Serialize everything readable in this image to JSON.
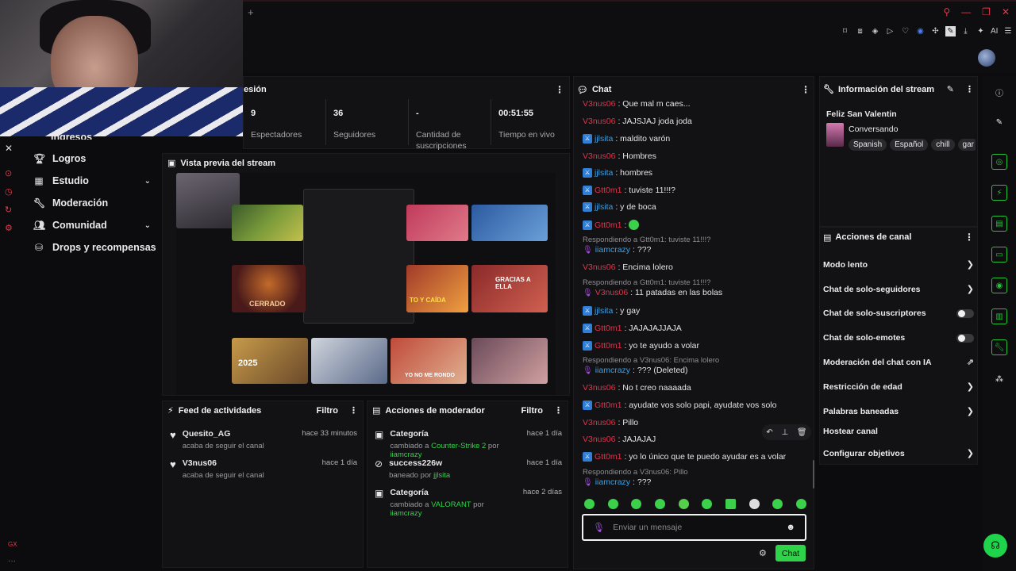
{
  "browser": {
    "new_tab": "+",
    "window_controls": [
      "⚲",
      "—",
      "❐",
      "✕"
    ],
    "ai_label": "AI"
  },
  "sidebar": {
    "partial_item": "Ingresos",
    "items": [
      {
        "label": "Logros",
        "icon": "trophy-icon"
      },
      {
        "label": "Estudio",
        "icon": "table-icon",
        "expandable": true
      },
      {
        "label": "Moderación",
        "icon": "wrench-icon"
      },
      {
        "label": "Comunidad",
        "icon": "people-icon",
        "expandable": true
      },
      {
        "label": "Drops y recompensas",
        "icon": "gift-icon"
      }
    ]
  },
  "session": {
    "title_partial": "esión",
    "stats": [
      {
        "value": "9",
        "label": "Espectadores"
      },
      {
        "value": "36",
        "label": "Seguidores"
      },
      {
        "value": "-",
        "label": "Cantidad de suscripciones"
      },
      {
        "value": "00:51:55",
        "label": "Tiempo en vivo"
      }
    ]
  },
  "preview": {
    "title": "Vista previa del stream",
    "thumb_texts": [
      "CERRADO",
      "2025",
      "GRACIAS A ELLA",
      "YO NO ME RONDO",
      "TO Y CAÍDA"
    ]
  },
  "feed": {
    "title": "Feed de actividades",
    "filter": "Filtro",
    "items": [
      {
        "user": "Quesito_AG",
        "action": "acaba de seguir el canal",
        "time": "hace 33 minutos"
      },
      {
        "user": "V3nus06",
        "action": "acaba de seguir el canal",
        "time": "hace 1 día"
      }
    ]
  },
  "mod_actions": {
    "title": "Acciones de moderador",
    "filter": "Filtro",
    "items": [
      {
        "title": "Categoría",
        "prefix": "cambiado a ",
        "target": "Counter-Strike 2",
        "by": " por ",
        "mod": "iiamcrazy",
        "time": "hace 1 día"
      },
      {
        "title": "success226w",
        "prefix": "baneado por ",
        "target": "",
        "by": "",
        "mod": "jjlsita",
        "time": "hace 1 día"
      },
      {
        "title": "Categoría",
        "prefix": "cambiado a ",
        "target": "VALORANT",
        "by": " por ",
        "mod": "iiamcrazy",
        "time": "hace 2 días"
      }
    ]
  },
  "chat": {
    "title": "Chat",
    "messages": [
      {
        "nick": "V3nus06",
        "color": "red",
        "text": ": Que mal m caes..."
      },
      {
        "nick": "V3nus06",
        "color": "red",
        "text": ": JAJSJAJ joda joda"
      },
      {
        "nick": "jjlsita",
        "color": "blue",
        "badge": true,
        "text": ": maldito varón"
      },
      {
        "nick": "V3nus06",
        "color": "red",
        "text": ": Hombres"
      },
      {
        "nick": "jjlsita",
        "color": "blue",
        "badge": true,
        "text": ": hombres"
      },
      {
        "nick": "Gtt0m1",
        "color": "red",
        "badge": true,
        "text": ": tuviste 11!!!?"
      },
      {
        "nick": "jjlsita",
        "color": "blue",
        "badge": true,
        "text": ": y de boca"
      },
      {
        "nick": "Gtt0m1",
        "color": "red",
        "badge": true,
        "text": ":",
        "emote": true
      },
      {
        "reply": "Respondiendo a Gtt0m1: tuviste 11!!!?",
        "nick": "iiamcrazy",
        "color": "blue",
        "text": ": ???"
      },
      {
        "nick": "V3nus06",
        "color": "red",
        "text": ": Encima lolero"
      },
      {
        "reply": "Respondiendo a Gtt0m1: tuviste 11!!!?",
        "nick": "V3nus06",
        "color": "red",
        "text": ": 11 patadas en las bolas"
      },
      {
        "nick": "jjlsita",
        "color": "blue",
        "badge": true,
        "text": ": y gay"
      },
      {
        "nick": "Gtt0m1",
        "color": "red",
        "badge": true,
        "text": ": JAJAJAJJAJA"
      },
      {
        "nick": "Gtt0m1",
        "color": "red",
        "badge": true,
        "text": ": yo te ayudo a volar"
      },
      {
        "reply": "Respondiendo a V3nus06: Encima lolero",
        "nick": "iiamcrazy",
        "color": "blue",
        "text": ": ??? (Deleted)"
      },
      {
        "nick": "V3nus06",
        "color": "red",
        "text": ": No t creo naaaada"
      },
      {
        "nick": "Gtt0m1",
        "color": "red",
        "badge": true,
        "text": ": ayudate vos solo papi, ayudate vos solo"
      },
      {
        "nick": "V3nus06",
        "color": "red",
        "text": ": Pillo"
      },
      {
        "nick": "V3nus06",
        "color": "red",
        "text": ": JAJAJAJ"
      },
      {
        "nick": "Gtt0m1",
        "color": "red",
        "badge": true,
        "text": ": yo lo único que te puedo ayudar es a volar"
      },
      {
        "reply": "Respondiendo a V3nus06: Pillo",
        "nick": "iiamcrazy",
        "color": "blue",
        "text": ": ???"
      }
    ],
    "input_placeholder": "Enviar un mensaje",
    "send_label": "Chat"
  },
  "stream_info": {
    "title": "Información del stream",
    "stream_title": "Feliz San Valentin",
    "category": "Conversando",
    "tags": [
      "Spanish",
      "Español",
      "chill",
      "gar"
    ]
  },
  "channel_actions": {
    "title": "Acciones de canal",
    "items": [
      {
        "label": "Modo lento",
        "control": "chevron"
      },
      {
        "label": "Chat de solo-seguidores",
        "control": "chevron"
      },
      {
        "label": "Chat de solo-suscriptores",
        "control": "toggle",
        "on": false
      },
      {
        "label": "Chat de solo-emotes",
        "control": "toggle",
        "on": false
      },
      {
        "label": "Moderación del chat con IA",
        "control": "external"
      },
      {
        "label": "Restricción de edad",
        "control": "chevron"
      },
      {
        "label": "Palabras baneadas",
        "control": "chevron"
      },
      {
        "label": "Hostear canal",
        "control": "none"
      },
      {
        "label": "Configurar objetivos",
        "control": "chevron"
      }
    ]
  },
  "colors": {
    "accent": "#2fd34a",
    "nick_red": "#d9364c",
    "nick_blue": "#3aa0e6",
    "panel": "#121214"
  }
}
